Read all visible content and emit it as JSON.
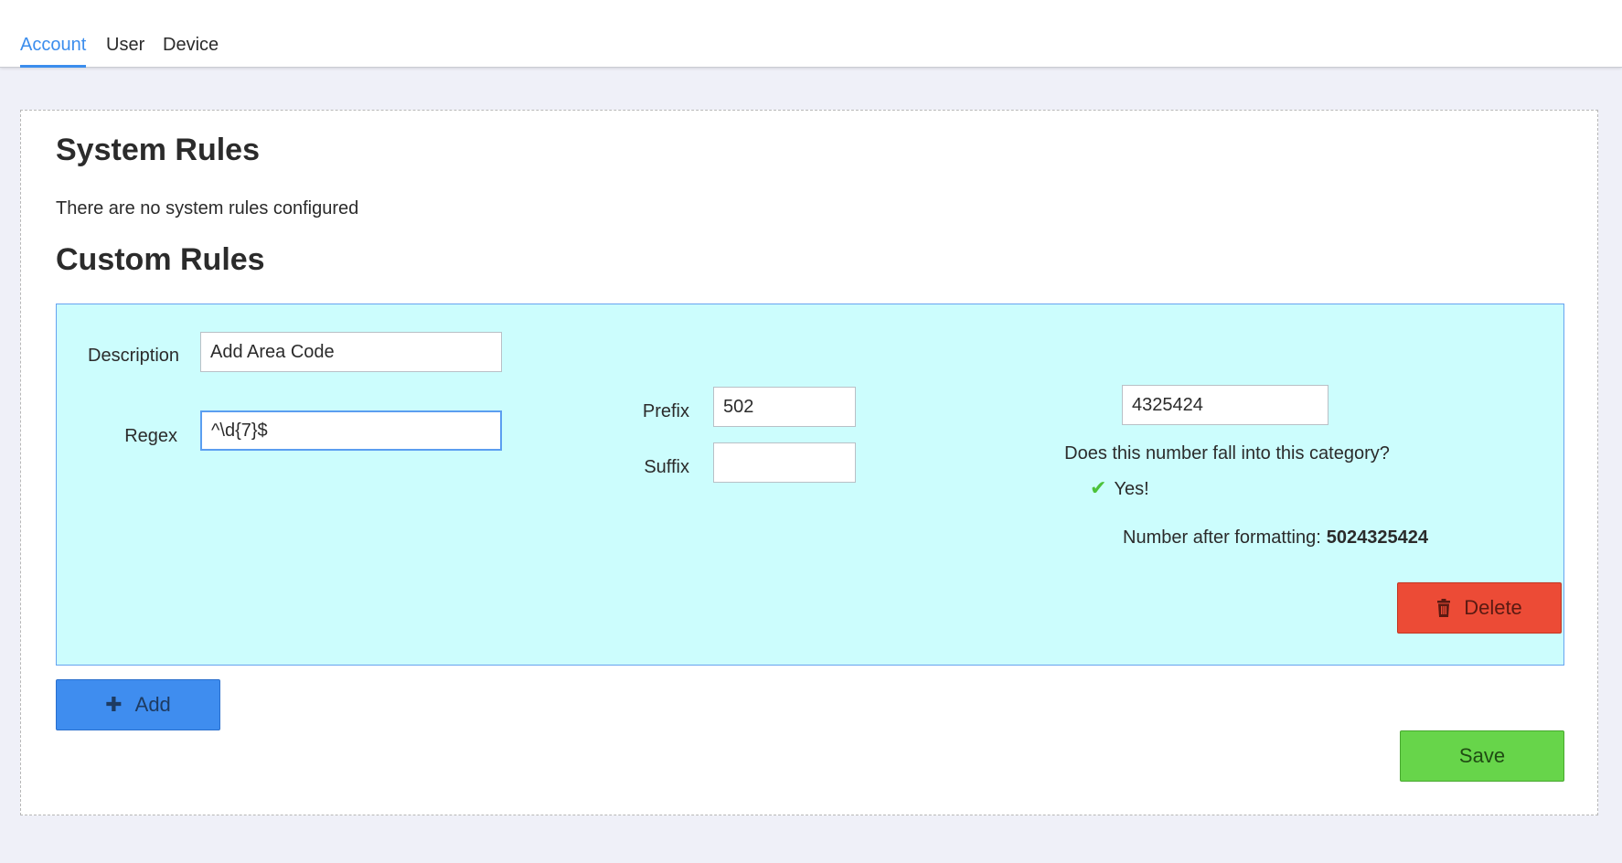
{
  "tabs": {
    "account": "Account",
    "user": "User",
    "device": "Device"
  },
  "system_rules": {
    "title": "System Rules",
    "empty_text": "There are no system rules configured"
  },
  "custom_rules": {
    "title": "Custom Rules",
    "rule": {
      "description_label": "Description",
      "description_value": "Add Area Code",
      "regex_label": "Regex",
      "regex_value": "^\\d{7}$",
      "prefix_label": "Prefix",
      "prefix_value": "502",
      "suffix_label": "Suffix",
      "suffix_value": "",
      "test_number": "4325424",
      "question": "Does this number fall into this category?",
      "answer": "Yes!",
      "formatted_label": "Number after formatting:",
      "formatted_value": "5024325424",
      "delete_label": "Delete"
    },
    "add_label": "Add"
  },
  "save_label": "Save",
  "colors": {
    "accent": "#3b8ded",
    "rule_bg": "#ccfdfd",
    "delete": "#ec4b36",
    "add": "#3f8def",
    "save": "#67d54a",
    "check": "#4cc23a"
  },
  "icons": {
    "check": "check-icon",
    "trash": "trash-icon",
    "plus": "plus-icon"
  }
}
